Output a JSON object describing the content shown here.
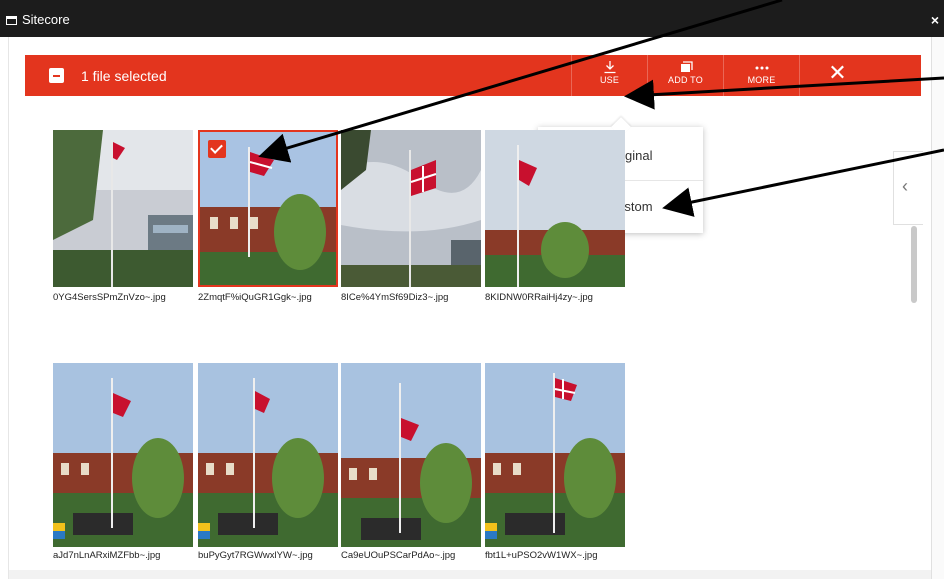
{
  "window": {
    "title": "Sitecore",
    "close_symbol": "×"
  },
  "toolbar": {
    "selection_text": "1 file selected",
    "use_label": "USE",
    "add_to_label": "ADD TO",
    "more_label": "MORE",
    "close_symbol": "✕"
  },
  "dropdown": {
    "items": [
      {
        "label": "Use Original",
        "icon": "download-icon"
      },
      {
        "label": "Use Custom",
        "icon": "crop-icon"
      }
    ]
  },
  "side_toggle": {
    "symbol": "‹"
  },
  "files": [
    {
      "name": "0YG4SersSPmZnVzo~.jpg",
      "selected": false
    },
    {
      "name": "2ZmqtF%iQuGR1Ggk~.jpg",
      "selected": true
    },
    {
      "name": "8ICe%4YmSf69Diz3~.jpg",
      "selected": false
    },
    {
      "name": "8KIDNW0RRaiHj4zy~.jpg",
      "selected": false
    },
    {
      "name": "aJd7nLnARxiMZFbb~.jpg",
      "selected": false
    },
    {
      "name": "buPyGyt7RGWwxlYW~.jpg",
      "selected": false
    },
    {
      "name": "Ca9eUOuPSCarPdAo~.jpg",
      "selected": false
    },
    {
      "name": "fbt1L+uPSO2vW1WX~.jpg",
      "selected": false
    }
  ],
  "colors": {
    "accent": "#e3351e",
    "titlebar": "#1c1c1c"
  }
}
